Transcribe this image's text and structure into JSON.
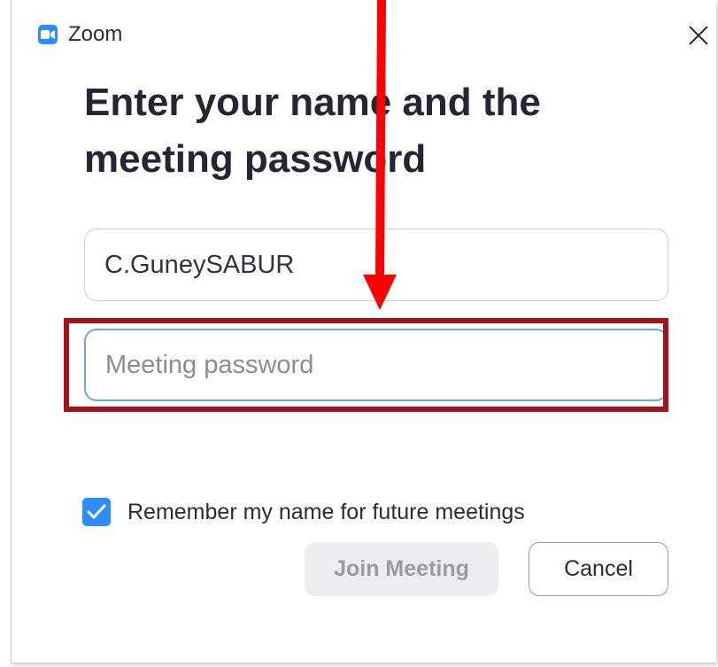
{
  "window": {
    "app_icon": "zoom-camera-icon",
    "title": "Zoom",
    "close_icon": "close-icon"
  },
  "dialog": {
    "heading": "Enter your name and the meeting password",
    "name_field": {
      "value": "C.GuneySABUR",
      "placeholder": ""
    },
    "password_field": {
      "value": "",
      "placeholder": "Meeting password"
    },
    "remember_checkbox": {
      "checked": true,
      "label": "Remember my name for future meetings"
    },
    "join_button": {
      "label": "Join Meeting",
      "enabled": false
    },
    "cancel_button": {
      "label": "Cancel"
    }
  },
  "annotation": {
    "arrow_color": "#ff0000",
    "highlight_color": "#a8101a",
    "target": "password_field"
  },
  "colors": {
    "accent": "#2d8cff",
    "focus_border": "#6ea7e8",
    "heading_text": "#252533"
  }
}
